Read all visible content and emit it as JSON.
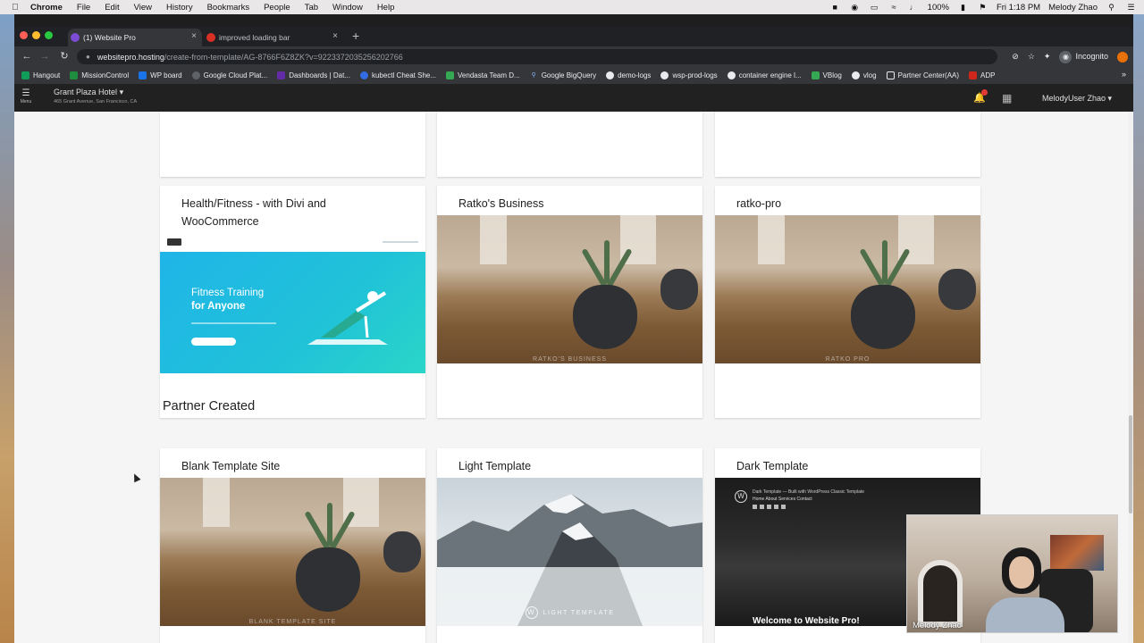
{
  "mac_menubar": {
    "app": "Chrome",
    "items": [
      "File",
      "Edit",
      "View",
      "History",
      "Bookmarks",
      "People",
      "Tab",
      "Window",
      "Help"
    ],
    "battery": "100%",
    "clock": "Fri 1:18 PM",
    "user": "Melody Zhao"
  },
  "browser": {
    "tabs": [
      {
        "label": "(1) Website Pro",
        "active": true
      },
      {
        "label": "improved loading bar",
        "active": false
      }
    ],
    "url_host": "websitepro.hosting",
    "url_path": "/create-from-template/AG-8766F6Z8ZK?v=9223372035256202766",
    "profile_label": "Incognito",
    "bookmarks": [
      {
        "label": "Hangout",
        "icon": "hangout-icon"
      },
      {
        "label": "MissionControl",
        "icon": "mission-icon"
      },
      {
        "label": "WP board",
        "icon": "wp-icon"
      },
      {
        "label": "Google Cloud Plat...",
        "icon": "cloud-icon"
      },
      {
        "label": "Dashboards | Dat...",
        "icon": "datadog-icon"
      },
      {
        "label": "kubectl Cheat She...",
        "icon": "kube-icon"
      },
      {
        "label": "Vendasta Team D...",
        "icon": "team-icon"
      },
      {
        "label": "Google BigQuery",
        "icon": "bigquery-icon"
      },
      {
        "label": "demo-logs",
        "icon": "logs-icon"
      },
      {
        "label": "wsp-prod-logs",
        "icon": "logs-icon"
      },
      {
        "label": "container engine l...",
        "icon": "logs-icon"
      },
      {
        "label": "VBlog",
        "icon": "vblog-icon"
      },
      {
        "label": "vlog",
        "icon": "logs-icon"
      },
      {
        "label": "Partner Center(AA)",
        "icon": "folder-icon"
      },
      {
        "label": "ADP",
        "icon": "adp-icon"
      }
    ]
  },
  "app_header": {
    "menu_label": "Menu",
    "business_name": "Grant Plaza Hotel",
    "business_address": "465 Grant Avenue, San Francisco, CA",
    "user_name": "MelodyUser Zhao"
  },
  "templates": {
    "row1": [
      {
        "title": "Health/Fitness - with Divi and WooCommerce"
      },
      {
        "title": "Ratko's Business",
        "thumb_caption": "RATKO'S BUSINESS"
      },
      {
        "title": "ratko-pro",
        "thumb_caption": "RATKO PRO"
      }
    ],
    "fitness_hero": {
      "line1": "Fitness Training",
      "line2": "for Anyone"
    },
    "section_title": "Partner Created",
    "row2": [
      {
        "title": "Blank Template Site",
        "thumb_caption": "BLANK TEMPLATE SITE"
      },
      {
        "title": "Light Template",
        "thumb_caption": "LIGHT TEMPLATE"
      },
      {
        "title": "Dark Template"
      }
    ],
    "dark_preview": {
      "site_title": "Dark Template",
      "tagline": "Built with WordPress Classic Template",
      "nav": "Home  About  Services  Contact",
      "welcome": "Welcome to Website Pro!"
    }
  },
  "webcam": {
    "name": "Melody Zhao"
  },
  "colors": {
    "accent": "#1a73e8",
    "fitness": "#20c2d8",
    "card_bg": "#ffffff",
    "page_bg": "#f5f5f5"
  }
}
